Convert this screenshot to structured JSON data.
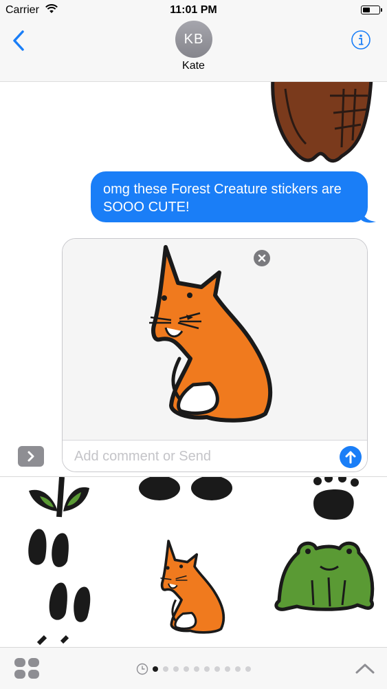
{
  "status": {
    "carrier": "Carrier",
    "time": "11:01 PM",
    "battery_level": 0.45
  },
  "header": {
    "avatar_initials": "KB",
    "contact_name": "Kate",
    "back_icon": "chevron-left-icon",
    "info_icon": "info-icon"
  },
  "messages": {
    "sent_text": "omg these Forest Creature stickers are SOOO CUTE!",
    "top_sticker": "owl-sticker"
  },
  "compose": {
    "preview_sticker": "fox-sticker",
    "placeholder": "Add comment or Send",
    "send_icon": "arrow-up-icon",
    "remove_icon": "close-icon",
    "expand_icon": "chevron-right-icon"
  },
  "drawer": {
    "stickers": [
      "sprout-sticker",
      "tracks-sticker",
      "paw-print-sticker",
      "hoof-prints-sticker",
      "fox-sticker",
      "frog-sticker"
    ]
  },
  "pager": {
    "page_count": 10,
    "current_page": 1
  },
  "colors": {
    "accent": "#1a7ef7",
    "fox": "#f07a1e",
    "owl": "#7a3a1c",
    "frog": "#5a9a34"
  }
}
